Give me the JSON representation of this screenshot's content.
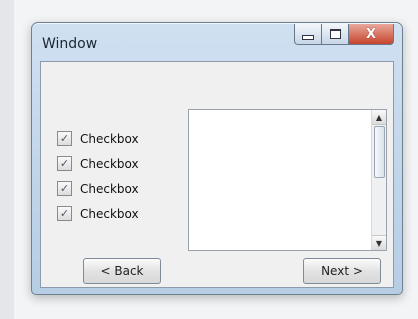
{
  "window": {
    "title": "Window",
    "controls": {
      "minimize": "minimize",
      "maximize": "maximize",
      "close": "X"
    }
  },
  "checkboxes": [
    {
      "label": "Checkbox",
      "checked": true
    },
    {
      "label": "Checkbox",
      "checked": true
    },
    {
      "label": "Checkbox",
      "checked": true
    },
    {
      "label": "Checkbox",
      "checked": true
    }
  ],
  "listbox": {
    "scroll_up": "▲",
    "scroll_down": "▼"
  },
  "buttons": {
    "back": "< Back",
    "next": "Next >"
  }
}
